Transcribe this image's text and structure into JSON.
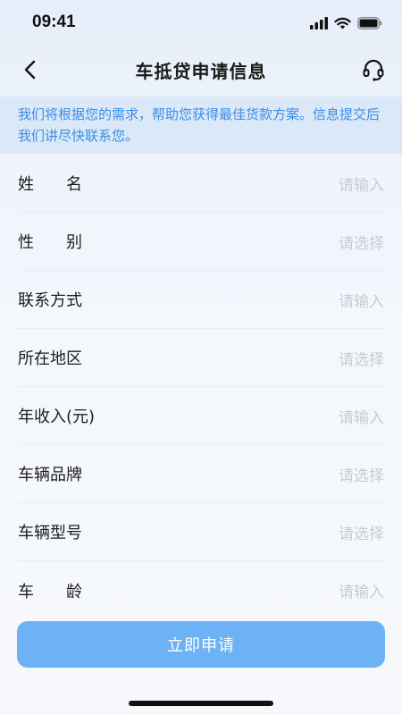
{
  "status_bar": {
    "time": "09:41",
    "icons": [
      "signal-icon",
      "wifi-icon",
      "battery-icon"
    ]
  },
  "nav": {
    "title": "车抵贷申请信息",
    "back_icon": "chevron-left-icon",
    "service_icon": "headset-icon"
  },
  "notice": {
    "text": "我们将根据您的需求，帮助您获得最佳货款方案。信息提交后我们讲尽快联系您。"
  },
  "form": {
    "fields": [
      {
        "label": "姓名",
        "placeholder": "请输入"
      },
      {
        "label": "性别",
        "placeholder": "请选择"
      },
      {
        "label": "联系方式",
        "placeholder": "请输入"
      },
      {
        "label": "所在地区",
        "placeholder": "请选择"
      },
      {
        "label": "年收入(元)",
        "placeholder": "请输入"
      },
      {
        "label": "车辆品牌",
        "placeholder": "请选择"
      },
      {
        "label": "车辆型号",
        "placeholder": "请选择"
      },
      {
        "label": "车龄",
        "placeholder": "请输入"
      }
    ]
  },
  "submit": {
    "label": "立即申请"
  },
  "colors": {
    "accent": "#3a8de6",
    "button": "#6db2f5",
    "notice_bg": "#dbe8f8",
    "placeholder": "#c8ccd2"
  }
}
